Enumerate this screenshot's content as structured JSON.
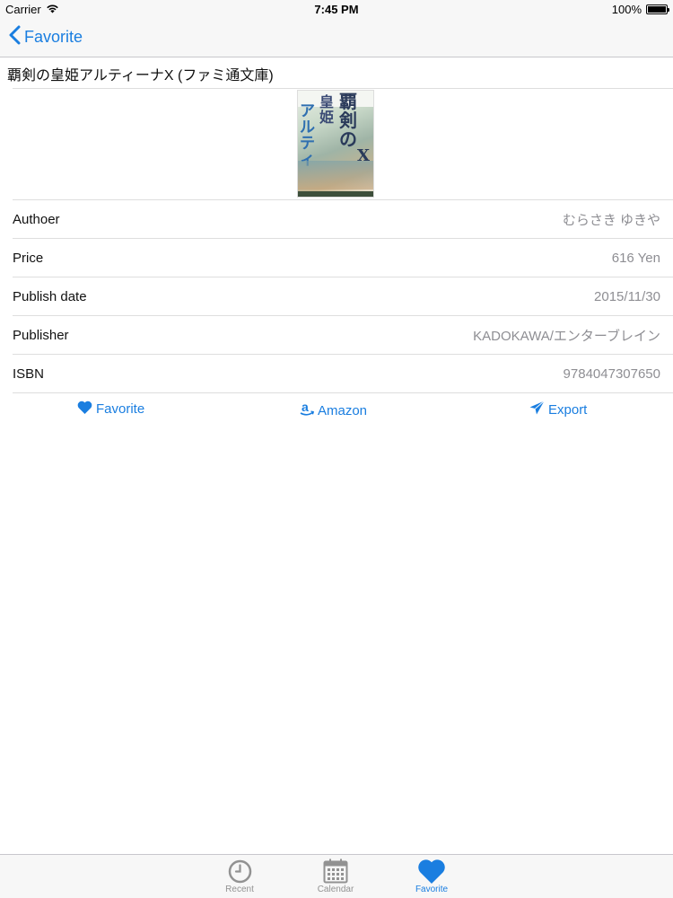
{
  "status_bar": {
    "carrier": "Carrier",
    "time": "7:45 PM",
    "battery": "100%",
    "battery_level": 1.0
  },
  "nav": {
    "back_label": "Favorite"
  },
  "book": {
    "title": "覇剣の皇姫アルティーナX (ファミ通文庫)",
    "details": [
      {
        "label": "Authoer",
        "value": "むらさき ゆきや"
      },
      {
        "label": "Price",
        "value": "616 Yen"
      },
      {
        "label": "Publish date",
        "value": "2015/11/30"
      },
      {
        "label": "Publisher",
        "value": "KADOKAWA/エンターブレイン"
      },
      {
        "label": "ISBN",
        "value": "9784047307650"
      }
    ]
  },
  "actions": {
    "favorite": "Favorite",
    "amazon": "Amazon",
    "export": "Export"
  },
  "tabs": [
    {
      "label": "Recent",
      "icon": "clock-icon",
      "active": false
    },
    {
      "label": "Calendar",
      "icon": "calendar-icon",
      "active": false
    },
    {
      "label": "Favorite",
      "icon": "heart-icon",
      "active": true
    }
  ],
  "colors": {
    "accent": "#1a7ee0",
    "secondary_text": "#8e8e93",
    "bar_background": "#f7f7f7"
  }
}
